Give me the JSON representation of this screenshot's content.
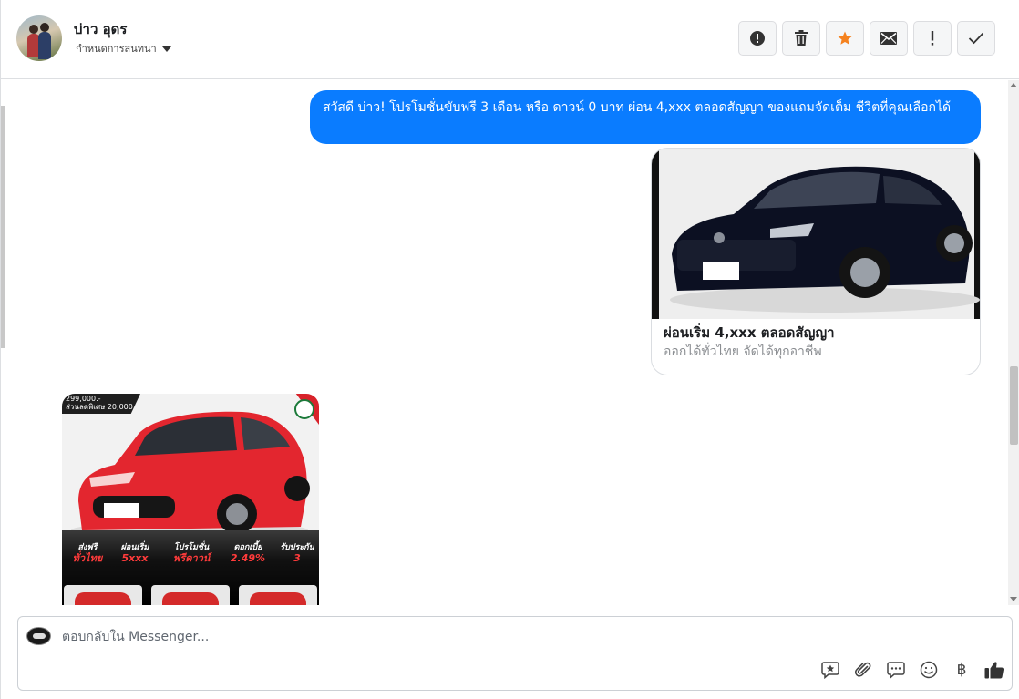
{
  "header": {
    "contact_name": "บ่าว อุดร",
    "status_label": "กำหนดการสนทนา",
    "actions": [
      {
        "name": "spam-button",
        "icon": "alert-circle-icon"
      },
      {
        "name": "delete-button",
        "icon": "trash-icon"
      },
      {
        "name": "star-button",
        "icon": "star-icon",
        "color": "#f5821f"
      },
      {
        "name": "mark-unread-button",
        "icon": "envelope-icon"
      },
      {
        "name": "important-button",
        "icon": "exclamation-icon"
      },
      {
        "name": "done-button",
        "icon": "check-icon"
      }
    ]
  },
  "messages": {
    "outgoing_text": "สวัสดี บ่าว! โปรโมชั่นขับฟรี 3 เดือน หรือ ดาวน์ 0 บาท ผ่อน 4,xxx ตลอดสัญญา ของแถมจัดเต็ม ชีวิตที่คุณเลือกได้",
    "card": {
      "title": "ผ่อนเริ่ม 4,xxx ตลอดสัญญา",
      "subtitle": "ออกได้ทั่วไทย จัดได้ทุกอาชีพ"
    },
    "promo": {
      "price_line1": "299,000.-",
      "price_line2": "ส่วนลดพิเศษ 20,000.-",
      "features": [
        {
          "label": "ส่งฟรี",
          "value": "ทั่วไทย"
        },
        {
          "label": "ผ่อนเริ่ม",
          "value": "5xxx"
        },
        {
          "label": "โปรโมชั่น",
          "value": "ฟรีดาวน์"
        },
        {
          "label": "ดอกเบี้ย",
          "value": "2.49%"
        },
        {
          "label": "รับประกัน",
          "value": "3"
        }
      ]
    }
  },
  "composer": {
    "placeholder": "ตอบกลับใน Messenger...",
    "tools": [
      "saved-reply-icon",
      "paperclip-icon",
      "chat-bubble-icon",
      "smiley-icon",
      "baht-icon",
      "thumbs-up-icon"
    ],
    "baht_symbol": "฿"
  },
  "colors": {
    "accent": "#0a7cff",
    "star": "#f5821f"
  }
}
